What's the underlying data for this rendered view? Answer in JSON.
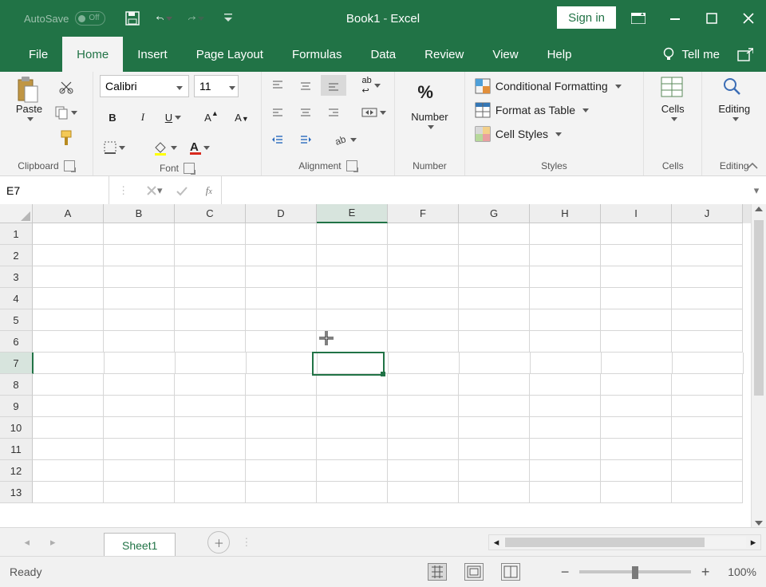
{
  "titlebar": {
    "autosave_label": "AutoSave",
    "autosave_state": "Off",
    "doc_name": "Book1",
    "app_name": "Excel",
    "signin": "Sign in"
  },
  "tabs": {
    "file": "File",
    "home": "Home",
    "insert": "Insert",
    "pagelayout": "Page Layout",
    "formulas": "Formulas",
    "data": "Data",
    "review": "Review",
    "view": "View",
    "help": "Help",
    "tellme": "Tell me"
  },
  "ribbon": {
    "clipboard": {
      "label": "Clipboard",
      "paste": "Paste"
    },
    "font": {
      "label": "Font",
      "name": "Calibri",
      "size": "11"
    },
    "alignment": {
      "label": "Alignment"
    },
    "number": {
      "label": "Number",
      "btn": "Number"
    },
    "styles": {
      "label": "Styles",
      "cond": "Conditional Formatting",
      "table": "Format as Table",
      "cell": "Cell Styles"
    },
    "cells": {
      "label": "Cells",
      "btn": "Cells"
    },
    "editing": {
      "label": "Editing",
      "btn": "Editing"
    }
  },
  "fxbar": {
    "namebox": "E7",
    "formula": ""
  },
  "grid": {
    "cols": [
      "A",
      "B",
      "C",
      "D",
      "E",
      "F",
      "G",
      "H",
      "I",
      "J"
    ],
    "rows": [
      "1",
      "2",
      "3",
      "4",
      "5",
      "6",
      "7",
      "8",
      "9",
      "10",
      "11",
      "12",
      "13"
    ],
    "active_col": 4,
    "active_row_index": 6
  },
  "sheets": {
    "active": "Sheet1"
  },
  "status": {
    "ready": "Ready",
    "zoom": "100%"
  }
}
